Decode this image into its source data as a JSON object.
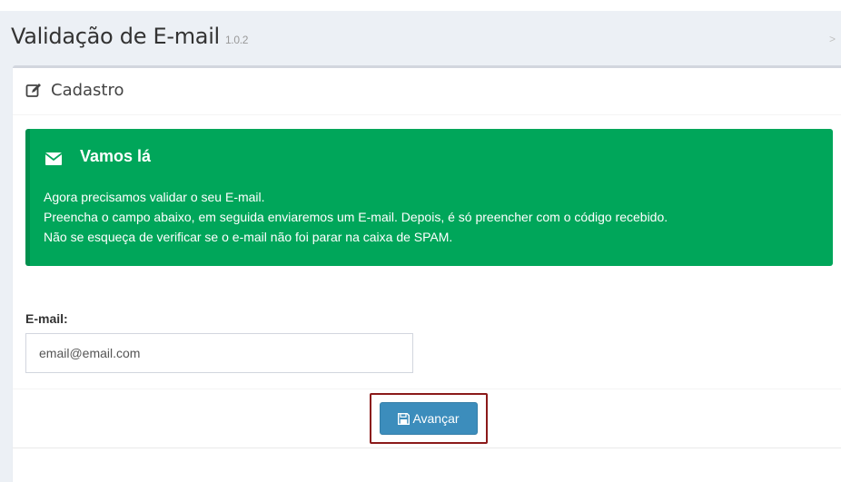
{
  "header": {
    "title": "Validação de E-mail",
    "version": "1.0.2",
    "breadcrumb_separator": ">"
  },
  "box": {
    "title": "Cadastro",
    "title_icon": "edit-icon"
  },
  "callout": {
    "title": "Vamos lá",
    "icon": "envelope-icon",
    "lines": [
      "Agora precisamos validar o seu E-mail.",
      "Preencha o campo abaixo, em seguida enviaremos um E-mail. Depois, é só preencher com o código recebido.",
      "Não se esqueça de verificar se o e-mail não foi parar na caixa de SPAM."
    ]
  },
  "form": {
    "email_label": "E-mail:",
    "email_placeholder": "email@email.com",
    "email_value": ""
  },
  "footer": {
    "submit_label": "Avançar",
    "submit_icon": "save-icon"
  },
  "colors": {
    "callout_background": "#00a65a",
    "button_background": "#3c8dbc",
    "highlight_frame": "#8b1a1a",
    "page_background": "#ecf0f5"
  }
}
